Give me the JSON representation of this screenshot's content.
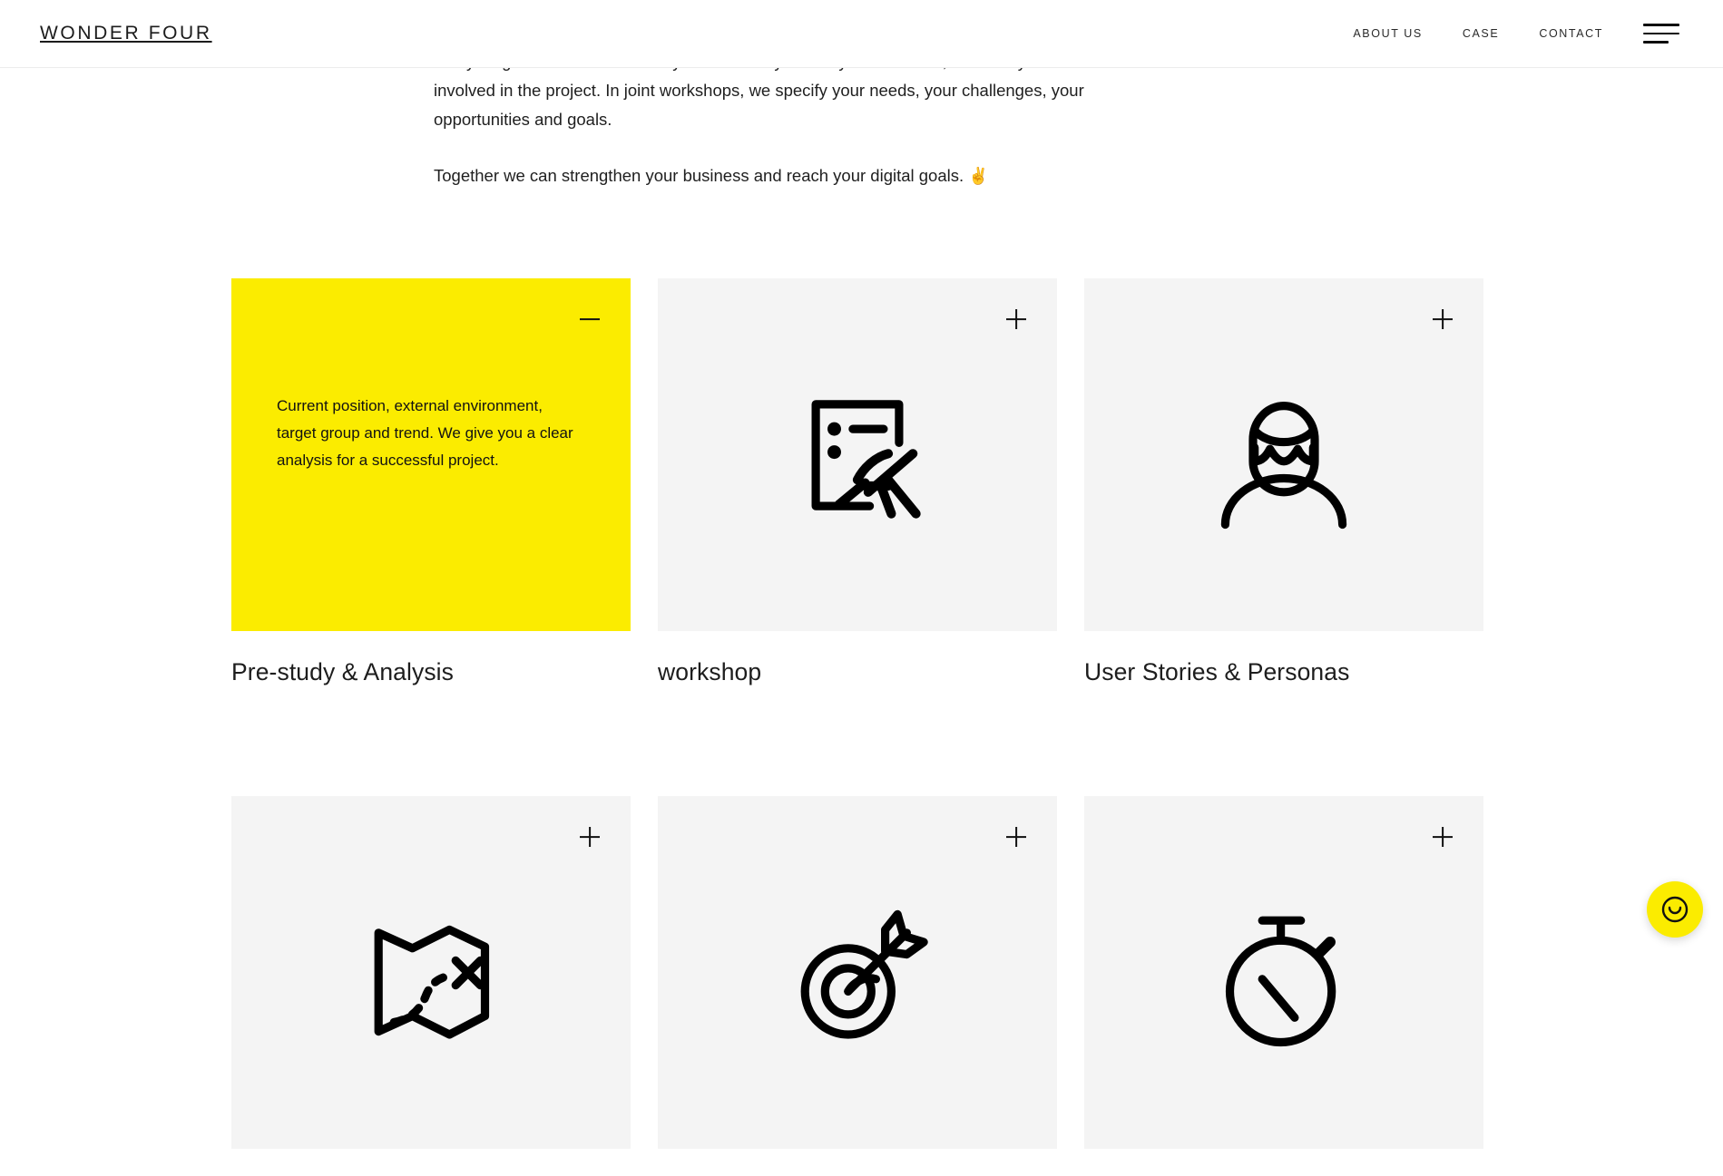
{
  "header": {
    "brand": "WONDER FOUR",
    "nav": [
      {
        "label": "ABOUT US"
      },
      {
        "label": "CASE"
      },
      {
        "label": "CONTACT"
      }
    ],
    "menu_icon": "hamburger-icon"
  },
  "intro": {
    "paragraph1": "everything we do. In order to fully understand you and your business, we want you to be involved in the project. In joint workshops, we specify your needs, your challenges, your opportunities and goals.",
    "paragraph2": "Together we can strengthen your business and reach your digital goals.",
    "paragraph2_emoji": "✌️"
  },
  "cards": [
    {
      "title": "Pre-study & Analysis",
      "expanded": true,
      "toggle": "minus",
      "body": "Current position, external environment, target group and trend. We give you a clear analysis for a successful project.",
      "icon": "",
      "bg": "#fbec00"
    },
    {
      "title": "workshop",
      "expanded": false,
      "toggle": "plus",
      "body": "",
      "icon": "clipboard-writing-icon",
      "bg": "#f4f4f4"
    },
    {
      "title": "User Stories & Personas",
      "expanded": false,
      "toggle": "plus",
      "body": "",
      "icon": "person-avatar-icon",
      "bg": "#f4f4f4"
    },
    {
      "title": "",
      "expanded": false,
      "toggle": "plus",
      "body": "",
      "icon": "treasure-map-icon",
      "bg": "#f4f4f4"
    },
    {
      "title": "",
      "expanded": false,
      "toggle": "plus",
      "body": "",
      "icon": "target-dart-icon",
      "bg": "#f4f4f4"
    },
    {
      "title": "",
      "expanded": false,
      "toggle": "plus",
      "body": "",
      "icon": "stopwatch-icon",
      "bg": "#f4f4f4"
    }
  ],
  "chat_widget": {
    "icon": "smiley-face-icon",
    "color": "#fbec00"
  },
  "colors": {
    "accent_yellow": "#fbec00",
    "card_gray": "#f4f4f4",
    "text": "#1c1c1c"
  }
}
